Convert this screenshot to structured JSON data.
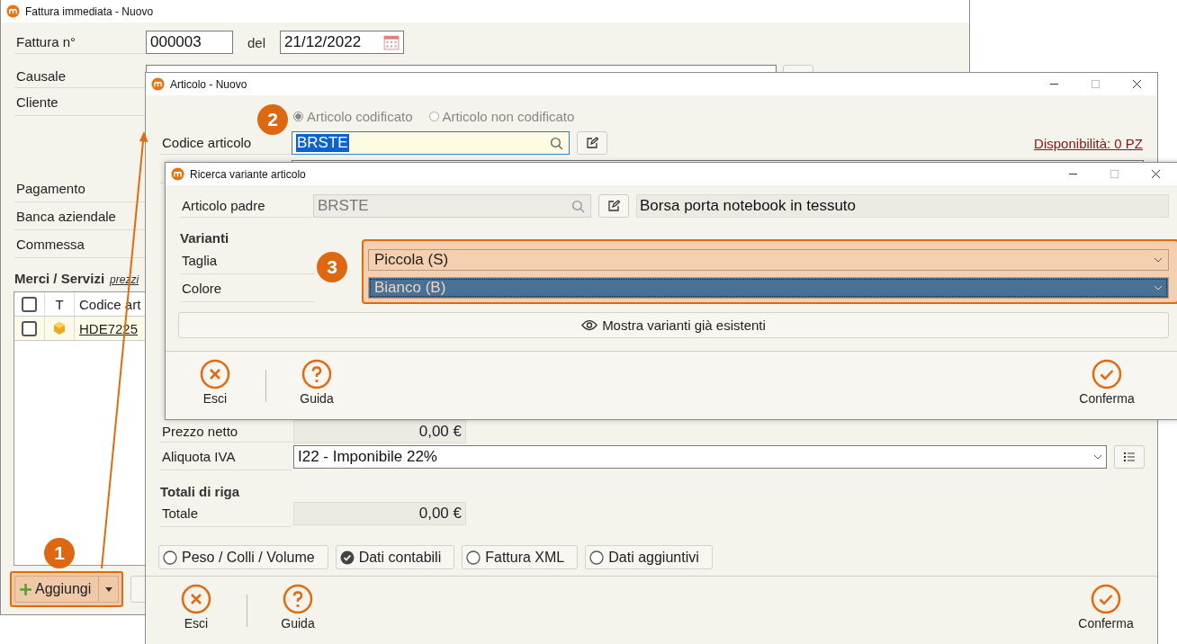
{
  "main_window": {
    "title": "Fattura immediata - Nuovo",
    "number": {
      "label": "Fattura n°",
      "value": "000003"
    },
    "date": {
      "label": "del",
      "value": "21/12/2022"
    },
    "labels_top": [
      "Causale",
      "Cliente"
    ],
    "labels_bottom": [
      "Pagamento",
      "Banca aziendale",
      "Commessa"
    ],
    "lines": {
      "title": "Merci / Servizi",
      "link": "prezzi",
      "header_checked": false,
      "columns": [
        "T",
        "Codice art"
      ],
      "rows": [
        {
          "checked": false,
          "code": "HDE7225"
        }
      ]
    },
    "add_button": "Aggiungi"
  },
  "articolo_window": {
    "title": "Articolo - Nuovo",
    "modes": [
      {
        "label": "Articolo codificato",
        "selected": true,
        "disabled": true
      },
      {
        "label": "Articolo non codificato",
        "selected": false,
        "disabled": true
      }
    ],
    "code": {
      "label": "Codice articolo",
      "value": "BRSTE"
    },
    "availability": "Disponibilità: 0 PZ",
    "net_price": {
      "label": "Prezzo netto",
      "value": "0,00 €"
    },
    "vat": {
      "label": "Aliquota IVA",
      "value": "I22 - Imponibile 22%"
    },
    "totals_heading": "Totali di riga",
    "total": {
      "label": "Totale",
      "value": "0,00 €"
    },
    "tabs": [
      {
        "label": "Peso / Colli / Volume",
        "checked": false
      },
      {
        "label": "Dati contabili",
        "checked": true
      },
      {
        "label": "Fattura XML",
        "checked": false
      },
      {
        "label": "Dati aggiuntivi",
        "checked": false
      }
    ],
    "actions": [
      {
        "label": "Esci",
        "kind": "exit"
      },
      {
        "label": "Guida",
        "kind": "help"
      },
      {
        "label": "Conferma",
        "kind": "confirm"
      }
    ]
  },
  "variant_window": {
    "title": "Ricerca variante articolo",
    "parent": {
      "label": "Articolo padre",
      "code": "BRSTE",
      "description": "Borsa porta notebook in tessuto"
    },
    "heading": "Varianti",
    "variants": [
      {
        "label": "Taglia",
        "value": "Piccola (S)",
        "selected": false
      },
      {
        "label": "Colore",
        "value": "Bianco (B)",
        "selected": true
      }
    ],
    "show_button": "Mostra varianti già esistenti",
    "actions": [
      {
        "label": "Esci",
        "kind": "exit"
      },
      {
        "label": "Guida",
        "kind": "help"
      },
      {
        "label": "Conferma",
        "kind": "confirm"
      }
    ]
  },
  "callouts": [
    "1",
    "2",
    "3"
  ]
}
